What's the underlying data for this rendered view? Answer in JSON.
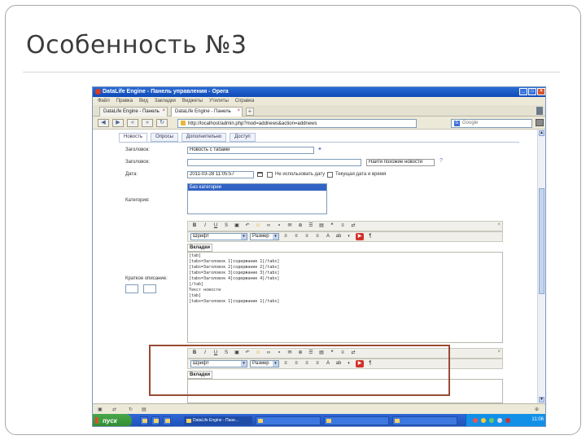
{
  "slide": {
    "title": "Особенность №3"
  },
  "browser": {
    "title": "DataLife Engine - Панель управления - Opera",
    "menu": [
      "Файл",
      "Правка",
      "Вид",
      "Закладки",
      "Виджеты",
      "Утилиты",
      "Справка"
    ],
    "tabs": [
      {
        "label": "DataLife Engine - Панель"
      },
      {
        "label": "DataLife Engine - Панель"
      }
    ],
    "url": "http://localhost/admin.php?mod=addnews&action=addnews",
    "search_placeholder": "Google"
  },
  "admin": {
    "tabs": [
      "Новость",
      "Опросы",
      "Дополнительно",
      "Доступ"
    ],
    "fields": {
      "title_label": "Заголовок:",
      "title_value": "Новость с табами",
      "alt_label": "Заголовок:",
      "alt_link": "Найти похожие новости",
      "date_label": "Дата:",
      "date_value": "2011-03-28 11:05:57",
      "date_option1": "Не использовать дату",
      "date_option2": "Текущая дата и время",
      "category_label": "Категория:",
      "category_selected": "Без категории",
      "thumb_label": "Краткое описание:"
    }
  },
  "editor1": {
    "font": "Шрифт",
    "size": "Размер",
    "tab_label": "Вкладки",
    "lines": [
      "[tab]",
      "",
      "[tabs=Заголовок 1]содержание 1[/tabs]",
      "[tabs=Заголовок 2]содержание 2[/tabs]",
      "[tabs=Заголовок 3]содержание 3[/tabs]",
      "[tabs=Заголовок 4]содержание 4[/tabs]",
      "",
      "[/tab]",
      "",
      "Текст новости",
      "",
      "",
      "[tab]",
      "",
      "[tabs=Заголовок 1]содержание 1[/tabs]"
    ]
  },
  "editor2": {
    "font": "Шрифт",
    "size": "Размер",
    "tab_label": "Вкладки"
  },
  "taskbar": {
    "start": "пуск",
    "items": [
      "DataLife Engine - Пане...",
      "",
      "",
      ""
    ],
    "clock": "11:06"
  },
  "colors": {
    "highlight_border": "#9a4a34",
    "titlebar": "#0d49b6"
  }
}
